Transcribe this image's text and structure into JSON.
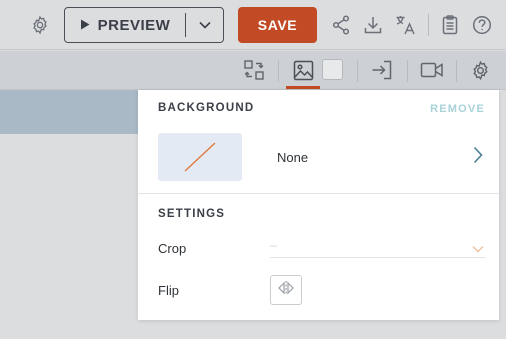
{
  "toolbar": {
    "settings_icon": "gear-icon",
    "preview_label": "PREVIEW",
    "save_label": "SAVE",
    "icons": [
      "share-icon",
      "download-icon",
      "translate-icon",
      "clipboard-icon",
      "help-icon"
    ]
  },
  "subtoolbar": {
    "icons": [
      "swap-icon",
      "image-icon",
      "color-swatch",
      "enter-icon",
      "video-icon",
      "gear-icon"
    ],
    "active_tab": "image-icon"
  },
  "panel": {
    "background": {
      "title": "BACKGROUND",
      "remove_label": "REMOVE",
      "value": "None"
    },
    "settings": {
      "title": "SETTINGS",
      "crop_label": "Crop",
      "crop_value": "–",
      "flip_label": "Flip"
    }
  },
  "colors": {
    "accent": "#c24b25",
    "remove_link": "#a9d3d8",
    "toolbar_bg": "#dcdddf",
    "subtoolbar_bg": "#cdd1d5"
  }
}
